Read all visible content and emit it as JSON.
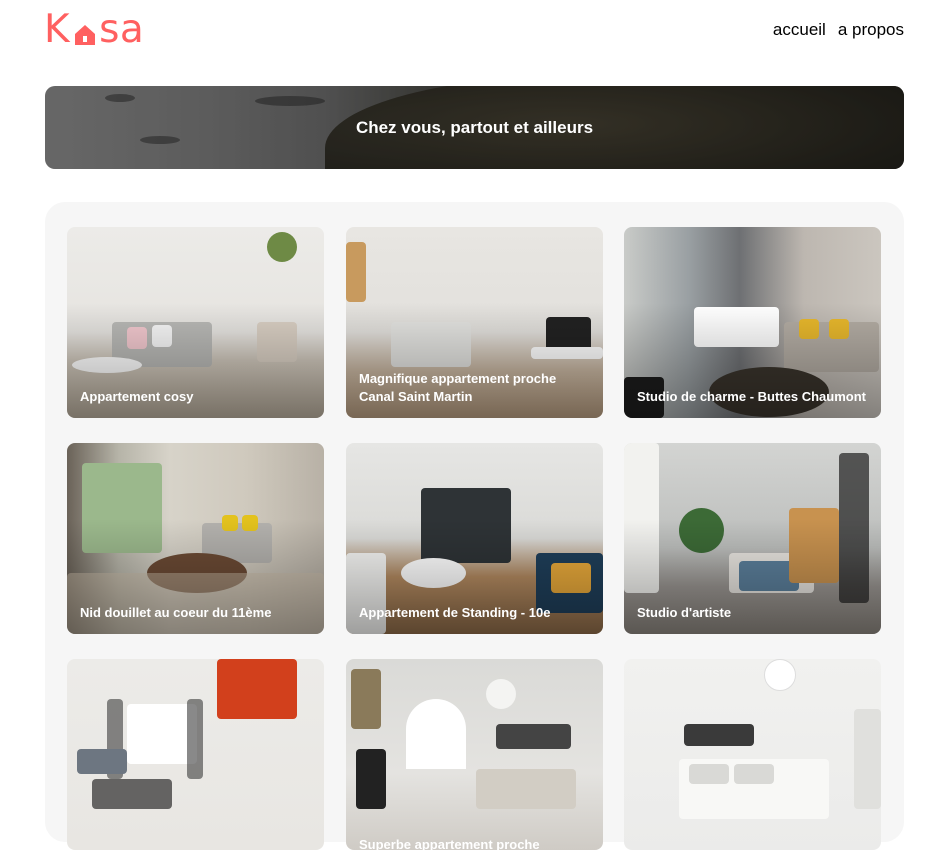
{
  "brand": {
    "logo_prefix": "K",
    "logo_suffix": "sa",
    "color": "#ff6060"
  },
  "nav": {
    "items": [
      {
        "label": "accueil"
      },
      {
        "label": "a propos"
      }
    ]
  },
  "banner": {
    "title": "Chez vous, partout et ailleurs"
  },
  "listings": [
    {
      "title": "Appartement cosy"
    },
    {
      "title": "Magnifique appartement proche Canal Saint Martin"
    },
    {
      "title": "Studio de charme - Buttes Chaumont"
    },
    {
      "title": "Nid douillet au coeur du 11ème"
    },
    {
      "title": "Appartement de Standing - 10e"
    },
    {
      "title": "Studio d'artiste"
    },
    {
      "title": ""
    },
    {
      "title": "Superbe appartement proche"
    },
    {
      "title": ""
    }
  ]
}
